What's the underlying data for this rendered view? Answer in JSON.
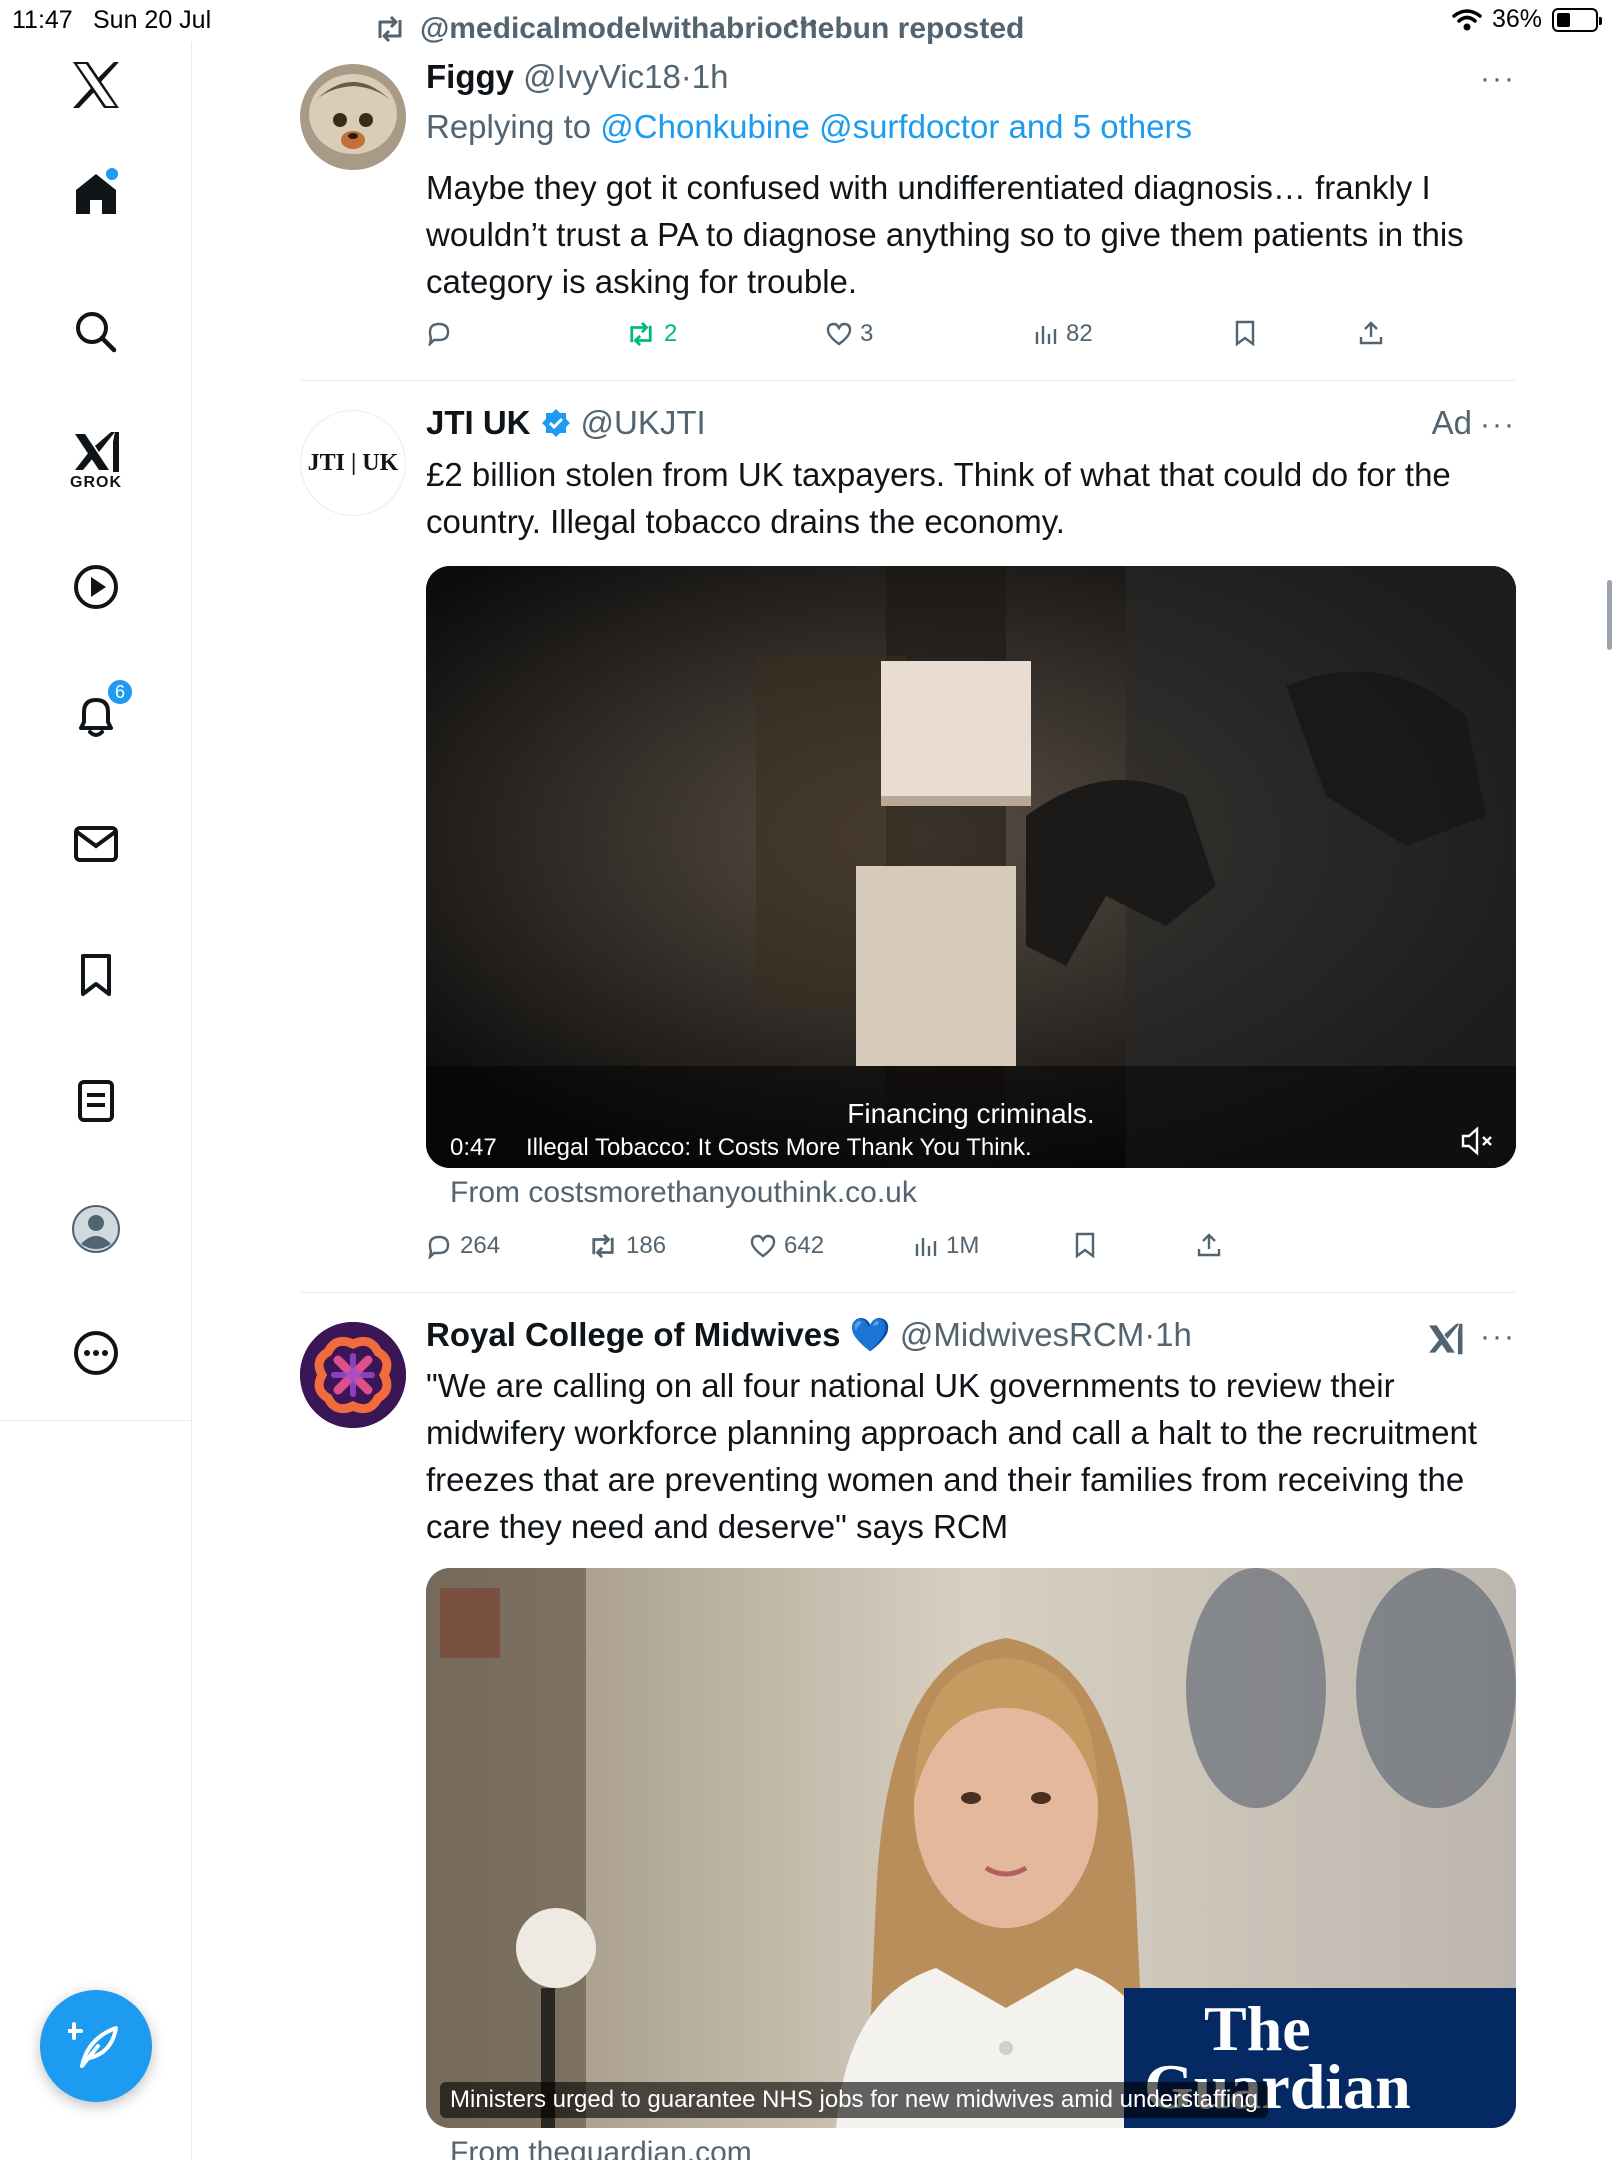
{
  "status_bar": {
    "time": "11:47",
    "date": "Sun 20 Jul",
    "battery": "36%",
    "battery_level": 0.36
  },
  "sidebar": {
    "grok_label": "GROK",
    "notifications_count": "6"
  },
  "tweets": [
    {
      "repost_label": "@medicalmodelwithabriochebun reposted",
      "name": "Figgy",
      "handle": "@IvyVic18",
      "sep": "·",
      "time": "1h",
      "reply_prefix": "Replying to",
      "reply_targets": "@Chonkubine @surfdoctor and 5 others",
      "text": "Maybe they got it confused with undifferentiated diagnosis… frankly I wouldn’t trust a PA to diagnose anything so to give them patients in this category is asking for trouble.",
      "reposts": "2",
      "likes": "3",
      "views": "82"
    },
    {
      "name": "JTI UK",
      "handle": "@UKJTI",
      "ad_label": "Ad",
      "avatar_text": "JTI | UK",
      "text": "£2 billion stolen from UK taxpayers. Think of what that could do for the country. Illegal tobacco drains the economy.",
      "video_subtitle": "Financing criminals.",
      "video_duration": "0:47",
      "video_title": "Illegal Tobacco: It Costs More Thank You Think.",
      "source": "From costsmorethanyouthink.co.uk",
      "replies": "264",
      "reposts": "186",
      "likes": "642",
      "views": "1M"
    },
    {
      "name": "Royal College of Midwives",
      "name_emoji": "💙",
      "handle": "@MidwivesRCM",
      "sep": "·",
      "time": "1h",
      "text": "\"We are calling on all four national UK governments to review their midwifery workforce planning approach and call a halt to the recruitment freezes that are preventing women and their families from receiving the care they need and deserve\" says RCM",
      "card_logo_line1": "The",
      "card_logo_line2": "Guardian",
      "card_caption": "Ministers urged to guarantee NHS jobs for new midwives amid understaffing",
      "source": "From theguardian.com"
    }
  ],
  "colors": {
    "accent": "#1d9bf0",
    "repost_green": "#00ba7c",
    "muted": "#536471",
    "guardian_navy": "#052962"
  }
}
